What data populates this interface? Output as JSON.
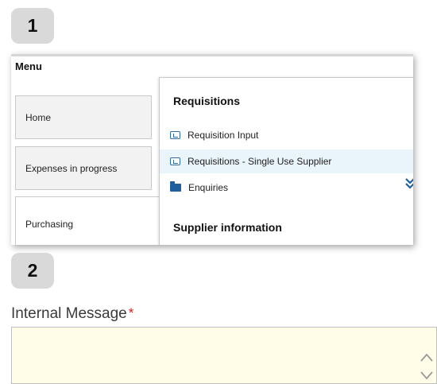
{
  "steps": {
    "one": "1",
    "two": "2"
  },
  "menu": {
    "title": "Menu",
    "left_items": [
      "Home",
      "Expenses in progress",
      "Purchasing"
    ],
    "submenu": {
      "heading": "Requisitions",
      "items": [
        {
          "label": "Requisition Input",
          "icon": "document-icon"
        },
        {
          "label": "Requisitions - Single Use Supplier",
          "icon": "document-icon",
          "highlighted": true
        },
        {
          "label": "Enquiries",
          "icon": "folder-icon"
        }
      ],
      "second_heading": "Supplier information"
    }
  },
  "form": {
    "label": "Internal Message",
    "required_marker": "*",
    "value": ""
  },
  "colors": {
    "accent": "#1f5f9e",
    "highlight": "#eaf4fb",
    "field_background": "#fffde8",
    "required": "#d62020"
  }
}
